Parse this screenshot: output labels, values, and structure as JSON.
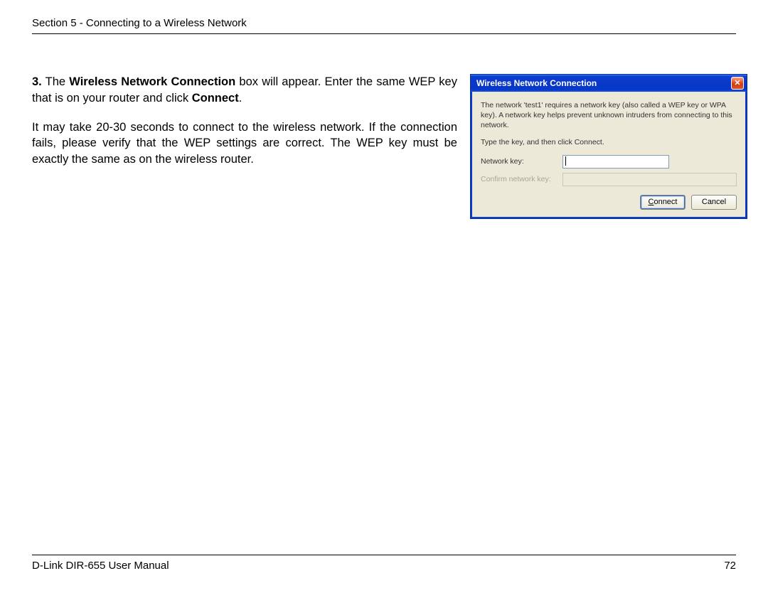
{
  "header": {
    "section_title": "Section 5 - Connecting to a Wireless Network"
  },
  "body": {
    "step_number": "3.",
    "step_pre": "The ",
    "step_bold1": "Wireless Network Connection",
    "step_mid": " box will appear. Enter the same WEP key that is on your router and click ",
    "step_bold2": "Connect",
    "step_end": ".",
    "para1": "It may take 20-30 seconds to connect to the wireless network. If the connection fails, please verify that the WEP settings are correct. The WEP key must be exactly the same as on the wireless router."
  },
  "dialog": {
    "title": "Wireless Network Connection",
    "info": "The network 'test1' requires a network key (also called a WEP key or WPA key). A network key helps prevent unknown intruders from connecting to this network.",
    "instruction": "Type the key, and then click Connect.",
    "label_key": "Network key:",
    "label_confirm": "Confirm network key:",
    "btn_connect_pre": "C",
    "btn_connect_rest": "onnect",
    "btn_cancel": "Cancel"
  },
  "footer": {
    "manual": "D-Link DIR-655 User Manual",
    "page": "72"
  }
}
